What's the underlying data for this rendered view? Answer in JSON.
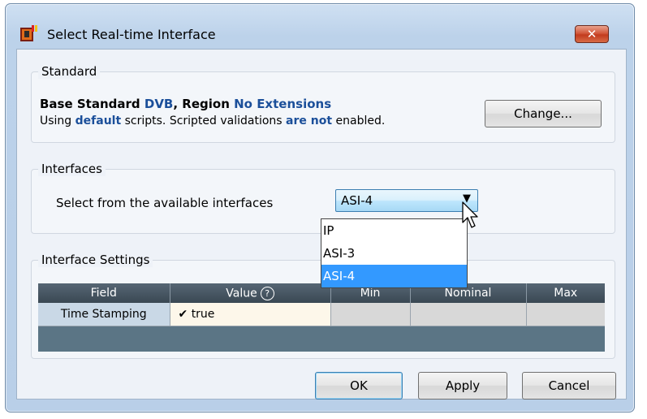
{
  "window": {
    "title": "Select Real-time Interface",
    "close_label": "✕"
  },
  "standard": {
    "legend": "Standard",
    "line1": {
      "prefix": "Base Standard ",
      "standard": "DVB",
      "mid": ", Region ",
      "region": "No Extensions"
    },
    "line2": {
      "prefix": "Using ",
      "scripts": "default",
      "mid": " scripts. Scripted validations ",
      "status": "are not",
      "suffix": " enabled."
    },
    "change_label": "Change..."
  },
  "interfaces": {
    "legend": "Interfaces",
    "label": "Select from the available interfaces",
    "selected": "ASI-4",
    "options": [
      "IP",
      "ASI-3",
      "ASI-4"
    ]
  },
  "settings": {
    "legend": "Interface Settings",
    "columns": [
      "Field",
      "Value",
      "Min",
      "Nominal",
      "Max"
    ],
    "rows": [
      {
        "field": "Time Stamping",
        "value": "true",
        "checked": true,
        "min": "",
        "nominal": "",
        "max": ""
      }
    ]
  },
  "buttons": {
    "ok": "OK",
    "apply": "Apply",
    "cancel": "Cancel"
  },
  "colors": {
    "highlight_text": "#1b4f9a",
    "selection": "#3399ff",
    "grid_header": "#3a4853",
    "grid_background": "#5b7585"
  },
  "icons": {
    "app": "app-logo-icon",
    "help": "help-circle-icon",
    "check": "checkmark-icon",
    "combo_arrow": "chevron-down-icon"
  }
}
